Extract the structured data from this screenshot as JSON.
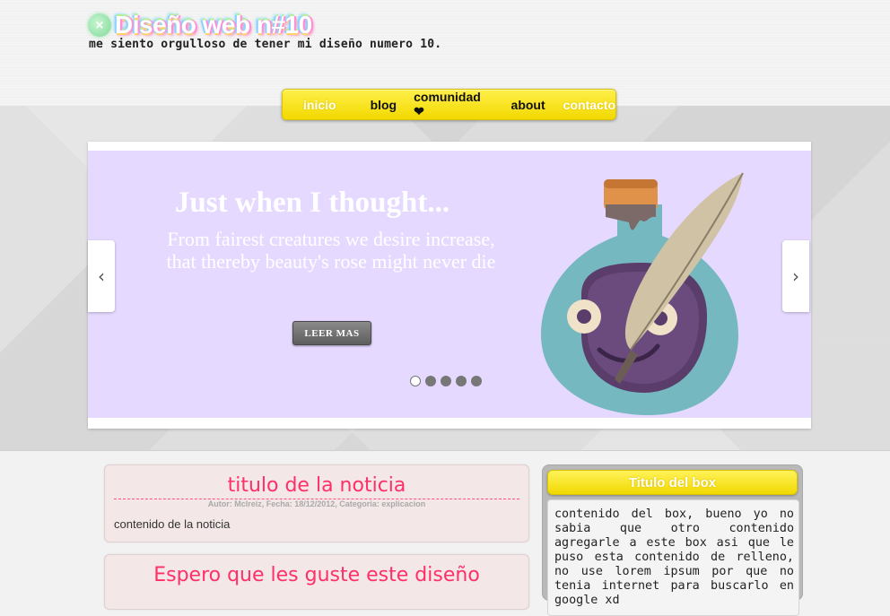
{
  "site": {
    "title": "Diseño web n#10",
    "subtitle": "me siento orgulloso de tener mi diseño numero 10."
  },
  "nav": {
    "items": [
      {
        "label": "inicio",
        "tone": "light"
      },
      {
        "label": "blog",
        "tone": "dark"
      },
      {
        "label": "comunidad ❤",
        "tone": "dark"
      },
      {
        "label": "about",
        "tone": "dark"
      },
      {
        "label": "contacto",
        "tone": "light"
      }
    ]
  },
  "slider": {
    "headline": "Just when I thought...",
    "body": "From fairest creatures we desire increase, that thereby beauty's rose might never die",
    "button_label": "LEER MAS",
    "prev_label": "‹",
    "next_label": "›",
    "slide_count": 5,
    "active_slide": 1,
    "background_color": "#e6d9ff"
  },
  "posts": [
    {
      "title": "titulo de la noticia",
      "meta": "Autor: Mclreiz, Fecha: 18/12/2012, Categoria: explicacion",
      "body": "contenido de la noticia"
    },
    {
      "title": "Espero que les guste este diseño",
      "meta": "",
      "body": ""
    }
  ],
  "sidebar_box": {
    "title": "Titulo del box",
    "body": "contenido del box, bueno yo no sabia que otro contenido agregarle a este box asi que le puso esta contenido de relleno, no use lorem ipsum por que no tenia internet para buscarlo en google xd"
  },
  "colors": {
    "accent_yellow": "#f2d900",
    "post_title_pink": "#ff2f67",
    "post_background": "#f3e7e7"
  }
}
